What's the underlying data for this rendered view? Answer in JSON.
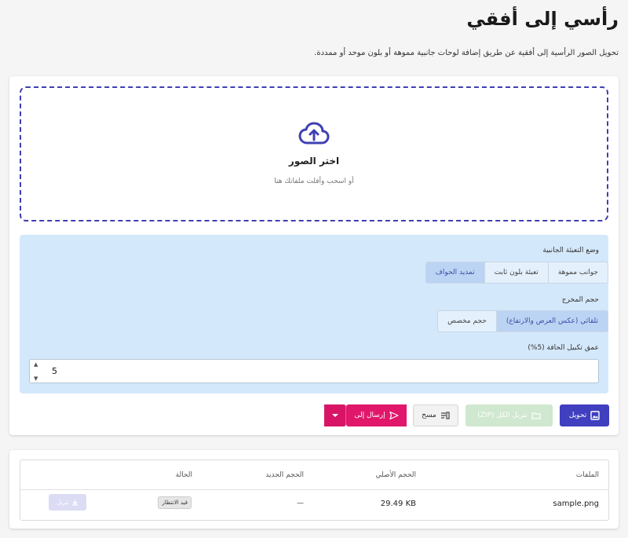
{
  "page": {
    "title": "رأسي إلى أفقي",
    "description": "تحويل الصور الرأسية إلى أفقية عن طريق إضافة لوحات جانبية مموهة أو بلون موحد أو ممددة."
  },
  "dropzone": {
    "icon": "cloud-upload-icon",
    "title": "اختر الصور",
    "hint": "أو اسحب وأفلت ملفاتك هنا"
  },
  "options": {
    "fill_mode": {
      "label": "وضع التعبئة الجانبية",
      "items": [
        "جوانب مموهة",
        "تعبئة بلون ثابت",
        "تمديد الحواف"
      ],
      "selected": "تمديد الحواف"
    },
    "output_size": {
      "label": "حجم المخرج",
      "items": [
        "تلقائي (عكس العرض والارتفاع)",
        "حجم مخصص"
      ],
      "selected": "تلقائي (عكس العرض والارتفاع)"
    },
    "edge_depth": {
      "label": "عمق تكبيل الحافة (5%)",
      "value": "5"
    }
  },
  "actions": {
    "convert": "تحويل",
    "download_all": "تنزيل الكل (ZIP)",
    "clear": "مسح",
    "send_to": "إرسال إلى"
  },
  "table": {
    "headers": {
      "name": "الملفات",
      "original_size": "الحجم الأصلي",
      "new_size": "الحجم الجديد",
      "status": "الحالة"
    },
    "rows": [
      {
        "name": "sample.png",
        "original_size": "29.49 KB",
        "new_size": "—",
        "status": "قيد الانتظار",
        "download": "تنزيل"
      }
    ]
  },
  "colors": {
    "primary": "#3f3fc0",
    "accent_pink": "#e0176a",
    "options_bg": "#d4e8fb",
    "download_disabled": "#cfe8cf"
  }
}
